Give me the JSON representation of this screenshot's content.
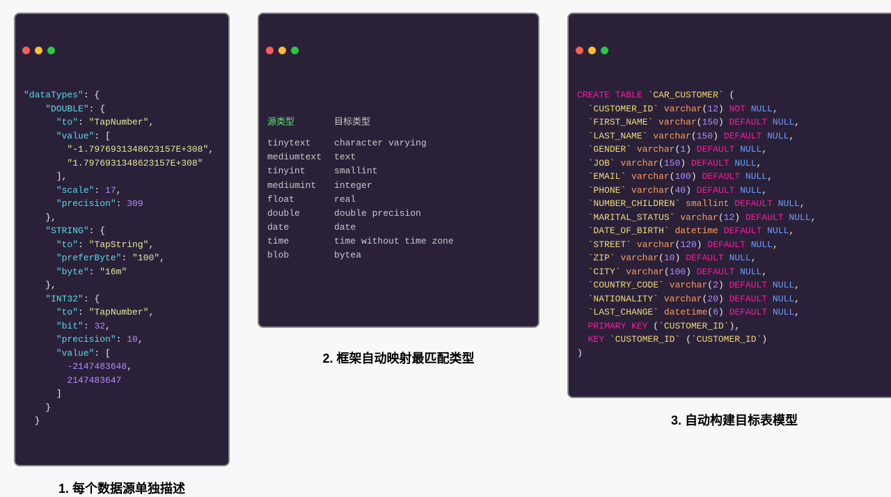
{
  "window1": {
    "dataTypes_key": "\"dataTypes\"",
    "DOUBLE_key": "\"DOUBLE\"",
    "DOUBLE_to_key": "\"to\"",
    "DOUBLE_to_val": "\"TapNumber\"",
    "DOUBLE_value_key": "\"value\"",
    "DOUBLE_value_0": "\"-1.7976931348623157E+308\"",
    "DOUBLE_value_1": "\"1.7976931348623157E+308\"",
    "DOUBLE_scale_key": "\"scale\"",
    "DOUBLE_scale_val": "17",
    "DOUBLE_precision_key": "\"precision\"",
    "DOUBLE_precision_val": "309",
    "STRING_key": "\"STRING\"",
    "STRING_to_key": "\"to\"",
    "STRING_to_val": "\"TapString\"",
    "STRING_preferByte_key": "\"preferByte\"",
    "STRING_preferByte_val": "\"100\"",
    "STRING_byte_key": "\"byte\"",
    "STRING_byte_val": "\"16m\"",
    "INT32_key": "\"INT32\"",
    "INT32_to_key": "\"to\"",
    "INT32_to_val": "\"TapNumber\"",
    "INT32_bit_key": "\"bit\"",
    "INT32_bit_val": "32",
    "INT32_precision_key": "\"precision\"",
    "INT32_precision_val": "10",
    "INT32_value_key": "\"value\"",
    "INT32_value_0": "-2147483648",
    "INT32_value_1": "2147483647"
  },
  "window2": {
    "heading_src": "源类型",
    "heading_dst": "目标类型",
    "rows": [
      {
        "src": "tinytext",
        "dst": "character varying"
      },
      {
        "src": "mediumtext",
        "dst": "text"
      },
      {
        "src": "tinyint",
        "dst": "smallint"
      },
      {
        "src": "mediumint",
        "dst": "integer"
      },
      {
        "src": "float",
        "dst": "real"
      },
      {
        "src": "double",
        "dst": "double precision"
      },
      {
        "src": "date",
        "dst": "date"
      },
      {
        "src": "time",
        "dst": "time without time zone"
      },
      {
        "src": "blob",
        "dst": "bytea"
      }
    ]
  },
  "window3": {
    "CREATE": "CREATE",
    "TABLE": "TABLE",
    "TABLENAME": "`CAR_CUSTOMER`",
    "NOT": "NOT",
    "NULL": "NULL",
    "DEFAULT": "DEFAULT",
    "PRIMARY": "PRIMARY",
    "KEY": "KEY",
    "varchar": "varchar",
    "smallint": "smallint",
    "datetime": "datetime",
    "cols": [
      {
        "name": "`CUSTOMER_ID`",
        "type": "varchar",
        "arg": "12",
        "tail": "NOT NULL"
      },
      {
        "name": "`FIRST_NAME`",
        "type": "varchar",
        "arg": "150",
        "tail": "DEFAULT NULL"
      },
      {
        "name": "`LAST_NAME`",
        "type": "varchar",
        "arg": "150",
        "tail": "DEFAULT NULL"
      },
      {
        "name": "`GENDER`",
        "type": "varchar",
        "arg": "1",
        "tail": "DEFAULT NULL"
      },
      {
        "name": "`JOB`",
        "type": "varchar",
        "arg": "150",
        "tail": "DEFAULT NULL"
      },
      {
        "name": "`EMAIL`",
        "type": "varchar",
        "arg": "100",
        "tail": "DEFAULT NULL"
      },
      {
        "name": "`PHONE`",
        "type": "varchar",
        "arg": "40",
        "tail": "DEFAULT NULL"
      },
      {
        "name": "`NUMBER_CHILDREN`",
        "type": "smallint",
        "arg": "",
        "tail": "DEFAULT NULL"
      },
      {
        "name": "`MARITAL_STATUS`",
        "type": "varchar",
        "arg": "12",
        "tail": "DEFAULT NULL"
      },
      {
        "name": "`DATE_OF_BIRTH`",
        "type": "datetime",
        "arg": "",
        "tail": "DEFAULT NULL"
      },
      {
        "name": "`STREET`",
        "type": "varchar",
        "arg": "120",
        "tail": "DEFAULT NULL"
      },
      {
        "name": "`ZIP`",
        "type": "varchar",
        "arg": "10",
        "tail": "DEFAULT NULL"
      },
      {
        "name": "`CITY`",
        "type": "varchar",
        "arg": "100",
        "tail": "DEFAULT NULL"
      },
      {
        "name": "`COUNTRY_CODE`",
        "type": "varchar",
        "arg": "2",
        "tail": "DEFAULT NULL"
      },
      {
        "name": "`NATIONALITY`",
        "type": "varchar",
        "arg": "20",
        "tail": "DEFAULT NULL"
      },
      {
        "name": "`LAST_CHANGE`",
        "type": "datetime",
        "arg": "6",
        "tail": "DEFAULT NULL"
      }
    ],
    "pk_col": "`CUSTOMER_ID`",
    "key_name": "`CUSTOMER_ID`",
    "key_col": "`CUSTOMER_ID`"
  },
  "captions": {
    "c1": "1. 每个数据源单独描述",
    "c2": "2. 框架自动映射最匹配类型",
    "c3": "3. 自动构建目标表模型"
  }
}
